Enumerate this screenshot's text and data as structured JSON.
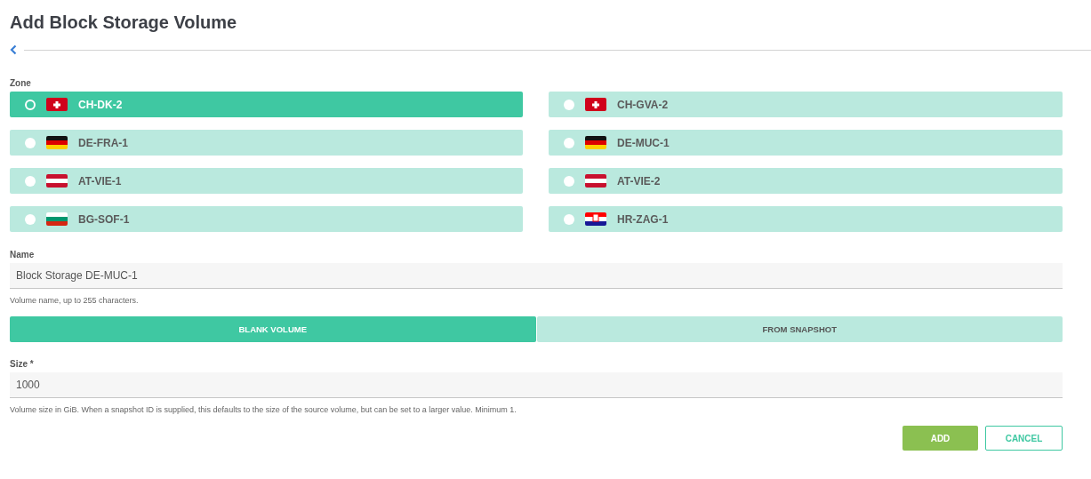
{
  "title": "Add Block Storage Volume",
  "zone": {
    "label": "Zone",
    "options": [
      {
        "name": "CH-DK-2",
        "kind": "ch",
        "selected": true
      },
      {
        "name": "CH-GVA-2",
        "kind": "ch",
        "selected": false
      },
      {
        "name": "DE-FRA-1",
        "kind": "de",
        "selected": false
      },
      {
        "name": "DE-MUC-1",
        "kind": "de",
        "selected": false
      },
      {
        "name": "AT-VIE-1",
        "kind": "at",
        "selected": false
      },
      {
        "name": "AT-VIE-2",
        "kind": "at",
        "selected": false
      },
      {
        "name": "BG-SOF-1",
        "kind": "bg",
        "selected": false
      },
      {
        "name": "HR-ZAG-1",
        "kind": "hr",
        "selected": false
      }
    ]
  },
  "name": {
    "label": "Name",
    "value": "Block Storage DE-MUC-1",
    "help": "Volume name, up to 255 characters."
  },
  "source_tabs": [
    {
      "label": "BLANK VOLUME",
      "selected": true
    },
    {
      "label": "FROM SNAPSHOT",
      "selected": false
    }
  ],
  "size": {
    "label": "Size *",
    "value": "1000",
    "help": "Volume size in GiB. When a snapshot ID is supplied, this defaults to the size of the source volume, but can be set to a larger value. Minimum 1."
  },
  "buttons": [
    {
      "label": "ADD",
      "kind": "primary"
    },
    {
      "label": "CANCEL",
      "kind": "secondary"
    }
  ]
}
